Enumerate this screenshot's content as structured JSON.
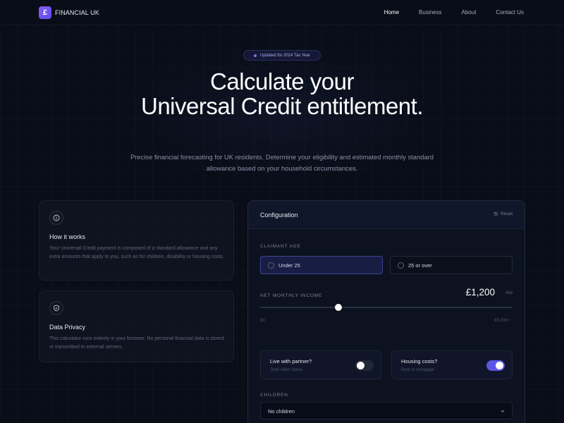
{
  "brand": {
    "logo_glyph": "£",
    "name": "FINANCIAL UK"
  },
  "nav": {
    "links": [
      "Home",
      "Business",
      "About",
      "Contact Us"
    ],
    "active": "Home"
  },
  "hero": {
    "badge": "Updated for 2024 Tax Year",
    "title_line1": "Calculate your",
    "title_line2": "Universal Credit entitlement.",
    "subtitle": "Precise financial forecasting for UK residents. Determine your eligibility and estimated monthly standard allowance based on your household circumstances."
  },
  "info_cards": [
    {
      "icon": "info-icon",
      "title": "How it works",
      "text": "Your Universal Credit payment is composed of a standard allowance and any extra amounts that apply to you, such as for children, disability or housing costs."
    },
    {
      "icon": "shield-icon",
      "title": "Data Privacy",
      "text": "This calculator runs entirely in your browser. No personal financial data is stored or transmitted to external servers."
    }
  ],
  "config": {
    "title": "Configuration",
    "reset_label": "Reset",
    "claimant_age": {
      "label": "CLAIMANT AGE",
      "options": [
        "Under 25",
        "25 or over"
      ],
      "selected": "Under 25"
    },
    "income": {
      "label": "NET MONTHLY INCOME",
      "value_display": "£1,200",
      "unit": "/mo",
      "min_label": "£0",
      "max_label": "£5,000+",
      "slider_fraction": 0.31
    },
    "toggles": [
      {
        "title": "Live with partner?",
        "subtitle": "Joint claim status",
        "on": false
      },
      {
        "title": "Housing costs?",
        "subtitle": "Rent or mortgage",
        "on": true
      }
    ],
    "children": {
      "label": "CHILDREN",
      "value": "No children"
    }
  },
  "colors": {
    "accent": "#5d55e6",
    "background": "#090d18",
    "selected_option": "#181d44"
  }
}
